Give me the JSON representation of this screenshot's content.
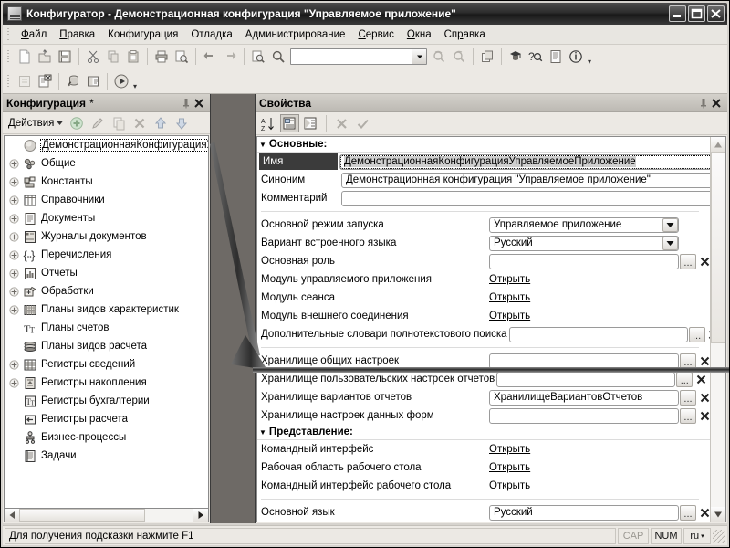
{
  "window": {
    "title": "Конфигуратор - Демонстрационная конфигурация \"Управляемое приложение\"",
    "icon": "app-icon",
    "minimize_label": "_",
    "maximize_label": "□",
    "close_label": "×"
  },
  "menubar": {
    "items": [
      {
        "label": "Файл",
        "accel": "Ф"
      },
      {
        "label": "Правка",
        "accel": "П"
      },
      {
        "label": "Конфигурация",
        "accel": "К"
      },
      {
        "label": "Отладка",
        "accel": "О"
      },
      {
        "label": "Администрирование",
        "accel": "А"
      },
      {
        "label": "Сервис",
        "accel": "С"
      },
      {
        "label": "Окна",
        "accel": "О"
      },
      {
        "label": "Справка",
        "accel": "р"
      }
    ]
  },
  "toolbar_main": {
    "search_value": "",
    "buttons": [
      {
        "name": "new-icon"
      },
      {
        "name": "open-icon"
      },
      {
        "name": "save-icon"
      },
      {
        "name": "cut-icon"
      },
      {
        "name": "copy-icon"
      },
      {
        "name": "paste-icon"
      },
      {
        "name": "print-icon"
      },
      {
        "name": "print-preview-icon"
      },
      {
        "name": "undo-icon"
      },
      {
        "name": "redo-icon"
      },
      {
        "name": "find-icon"
      },
      {
        "name": "search-icon"
      },
      {
        "name": "find-next-icon"
      },
      {
        "name": "find-previous-icon"
      },
      {
        "name": "windows-icon"
      },
      {
        "name": "syntax-assistant-icon"
      },
      {
        "name": "help-search-icon"
      },
      {
        "name": "content-icon"
      },
      {
        "name": "about-icon"
      },
      {
        "name": "toolbar-overflow-icon"
      }
    ]
  },
  "toolbar_second": {
    "buttons": [
      {
        "name": "config-tree-icon"
      },
      {
        "name": "config-check-icon"
      },
      {
        "name": "database-config-icon"
      },
      {
        "name": "config-compare-icon"
      },
      {
        "name": "start-debug-icon"
      },
      {
        "name": "toolbar-overflow-icon"
      }
    ]
  },
  "config_panel": {
    "title": "Конфигурация",
    "modified_marker": "*",
    "pin_icon": "pin-icon",
    "close_icon": "close-icon",
    "actions_label": "Действия",
    "toolbar_buttons": [
      {
        "name": "add-icon"
      },
      {
        "name": "edit-icon"
      },
      {
        "name": "copy-item-icon"
      },
      {
        "name": "delete-icon"
      },
      {
        "name": "move-up-icon"
      },
      {
        "name": "move-down-icon"
      }
    ],
    "tree": [
      {
        "label": "ДемонстрационнаяКонфигурацияУправ",
        "icon": "config-root-icon",
        "expander": "none",
        "indent": 0,
        "selected": true
      },
      {
        "label": "Общие",
        "icon": "common-icon",
        "expander": "plus",
        "indent": 1,
        "selected": false
      },
      {
        "label": "Константы",
        "icon": "constants-icon",
        "expander": "plus",
        "indent": 1,
        "selected": false
      },
      {
        "label": "Справочники",
        "icon": "catalogs-icon",
        "expander": "plus",
        "indent": 1,
        "selected": false
      },
      {
        "label": "Документы",
        "icon": "documents-icon",
        "expander": "plus",
        "indent": 1,
        "selected": false
      },
      {
        "label": "Журналы документов",
        "icon": "document-journals-icon",
        "expander": "plus",
        "indent": 1,
        "selected": false
      },
      {
        "label": "Перечисления",
        "icon": "enums-icon",
        "expander": "plus",
        "indent": 1,
        "selected": false
      },
      {
        "label": "Отчеты",
        "icon": "reports-icon",
        "expander": "plus",
        "indent": 1,
        "selected": false
      },
      {
        "label": "Обработки",
        "icon": "data-processors-icon",
        "expander": "plus",
        "indent": 1,
        "selected": false
      },
      {
        "label": "Планы видов характеристик",
        "icon": "chart-of-characteristic-types-icon",
        "expander": "plus",
        "indent": 1,
        "selected": false
      },
      {
        "label": "Планы счетов",
        "icon": "chart-of-accounts-icon",
        "expander": "none",
        "indent": 1,
        "selected": false
      },
      {
        "label": "Планы видов расчета",
        "icon": "chart-of-calculation-types-icon",
        "expander": "none",
        "indent": 1,
        "selected": false
      },
      {
        "label": "Регистры сведений",
        "icon": "information-registers-icon",
        "expander": "plus",
        "indent": 1,
        "selected": false
      },
      {
        "label": "Регистры накопления",
        "icon": "accumulation-registers-icon",
        "expander": "plus",
        "indent": 1,
        "selected": false
      },
      {
        "label": "Регистры бухгалтерии",
        "icon": "accounting-registers-icon",
        "expander": "none",
        "indent": 1,
        "selected": false
      },
      {
        "label": "Регистры расчета",
        "icon": "calculation-registers-icon",
        "expander": "none",
        "indent": 1,
        "selected": false
      },
      {
        "label": "Бизнес-процессы",
        "icon": "business-processes-icon",
        "expander": "none",
        "indent": 1,
        "selected": false
      },
      {
        "label": "Задачи",
        "icon": "tasks-icon",
        "expander": "none",
        "indent": 1,
        "selected": false
      }
    ]
  },
  "properties_panel": {
    "title": "Свойства",
    "pin_icon": "pin-icon",
    "close_icon": "close-icon",
    "toolbar_buttons": [
      {
        "name": "sort-alphabetical-icon",
        "pressed": false
      },
      {
        "name": "group-by-category-icon",
        "pressed": true
      },
      {
        "name": "property-list-icon",
        "pressed": false
      },
      {
        "name": "clear-value-icon",
        "pressed": false
      },
      {
        "name": "apply-value-icon",
        "pressed": false
      }
    ],
    "groups": [
      {
        "name": "Основные:",
        "rows": [
          {
            "label": "Имя",
            "type": "text",
            "value": "ДемонстрационнаяКонфигурацияУправляемоеПриложение",
            "selected": true
          },
          {
            "label": "Синоним",
            "type": "text",
            "value": "Демонстрационная конфигурация \"Управляемое приложение\"",
            "selected": false
          },
          {
            "label": "Комментарий",
            "type": "text",
            "value": "",
            "selected": false
          },
          {
            "type": "divider"
          },
          {
            "label": "Основной режим запуска",
            "type": "combo",
            "value": "Управляемое приложение",
            "selected": false
          },
          {
            "label": "Вариант встроенного языка",
            "type": "combo",
            "value": "Русский",
            "selected": false
          },
          {
            "label": "Основная роль",
            "type": "select",
            "value": "",
            "selected": false
          },
          {
            "label": "Модуль управляемого приложения",
            "type": "link",
            "value": "Открыть",
            "selected": false
          },
          {
            "label": "Модуль сеанса",
            "type": "link",
            "value": "Открыть",
            "selected": false
          },
          {
            "label": "Модуль внешнего соединения",
            "type": "link",
            "value": "Открыть",
            "selected": false
          },
          {
            "label": "Дополнительные словари полнотекстового поиска",
            "type": "select-wide",
            "value": "",
            "selected": false
          },
          {
            "type": "divider"
          },
          {
            "label": "Хранилище общих настроек",
            "type": "select",
            "value": "",
            "selected": false
          },
          {
            "label": "Хранилище пользовательских настроек отчетов",
            "type": "select-wide",
            "value": "",
            "selected": false
          },
          {
            "label": "Хранилище вариантов отчетов",
            "type": "select",
            "value": "ХранилищеВариантовОтчетов",
            "selected": false
          },
          {
            "label": "Хранилище настроек данных форм",
            "type": "select",
            "value": "",
            "selected": false
          }
        ]
      },
      {
        "name": "Представление:",
        "rows": [
          {
            "label": "Командный интерфейс",
            "type": "link",
            "value": "Открыть",
            "selected": false
          },
          {
            "label": "Рабочая область рабочего стола",
            "type": "link",
            "value": "Открыть",
            "selected": false
          },
          {
            "label": "Командный интерфейс рабочего стола",
            "type": "link",
            "value": "Открыть",
            "selected": false
          },
          {
            "type": "divider"
          },
          {
            "label": "Основной язык",
            "type": "select",
            "value": "Русский",
            "selected": false
          }
        ]
      }
    ]
  },
  "statusbar": {
    "message": "Для получения подсказки нажмите F1",
    "caps": "CAP",
    "num": "NUM",
    "lang": "ru"
  },
  "annotations": {
    "arrow": "pointer-arrow",
    "underline": "highlight-underline"
  },
  "colors": {
    "titlebar": "#2c2c2c",
    "chrome": "#ece9e4",
    "workspace": "#6e6a66",
    "selection": "#3b3b3b"
  }
}
